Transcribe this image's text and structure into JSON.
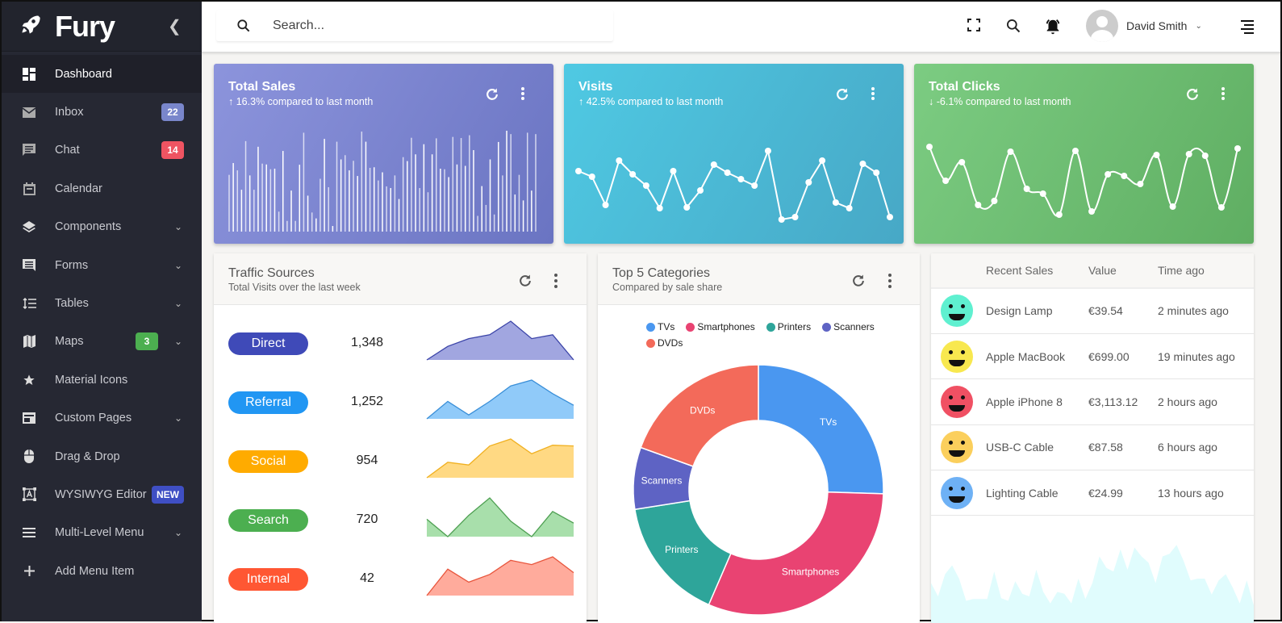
{
  "brand": {
    "name": "Fury"
  },
  "sidebar": {
    "items": [
      {
        "label": "Dashboard",
        "icon": "dashboard-icon",
        "active": true
      },
      {
        "label": "Inbox",
        "icon": "mail-icon",
        "badge": "22",
        "badge_color": "#7986cb"
      },
      {
        "label": "Chat",
        "icon": "chat-icon",
        "badge": "14",
        "badge_color": "#ef5462"
      },
      {
        "label": "Calendar",
        "icon": "calendar-icon"
      },
      {
        "label": "Components",
        "icon": "layers-icon",
        "expandable": true
      },
      {
        "label": "Forms",
        "icon": "forms-icon",
        "expandable": true
      },
      {
        "label": "Tables",
        "icon": "tables-icon",
        "expandable": true
      },
      {
        "label": "Maps",
        "icon": "map-icon",
        "badge": "3",
        "badge_color": "#4caf50",
        "expandable": true
      },
      {
        "label": "Material Icons",
        "icon": "star-icon"
      },
      {
        "label": "Custom Pages",
        "icon": "pages-icon",
        "expandable": true
      },
      {
        "label": "Drag & Drop",
        "icon": "mouse-icon"
      },
      {
        "label": "WYSIWYG Editor",
        "icon": "editor-icon",
        "badge": "NEW",
        "badge_color": "#3f4fc4"
      },
      {
        "label": "Multi-Level Menu",
        "icon": "menu-icon",
        "expandable": true
      },
      {
        "label": "Add Menu Item",
        "icon": "plus-icon"
      }
    ]
  },
  "topbar": {
    "search_placeholder": "Search...",
    "user_name": "David Smith"
  },
  "stats": [
    {
      "title": "Total Sales",
      "subtitle": "16.3% compared to last month",
      "trend": "up",
      "colors": [
        "#8c94dc",
        "#6a74c2"
      ]
    },
    {
      "title": "Visits",
      "subtitle": "42.5% compared to last month",
      "trend": "up",
      "colors": [
        "#4fc9e3",
        "#47a8c6"
      ]
    },
    {
      "title": "Total Clicks",
      "subtitle": "-6.1% compared to last month",
      "trend": "down",
      "colors": [
        "#7ccc82",
        "#5fae62"
      ]
    }
  ],
  "traffic": {
    "title": "Traffic Sources",
    "subtitle": "Total Visits over the last week",
    "rows": [
      {
        "label": "Direct",
        "value": "1,348",
        "color": "#3f4ab8",
        "fill": "#a1a6e0",
        "line": "#3b44a8",
        "spark": [
          0,
          35,
          55,
          65,
          100,
          55,
          65,
          0
        ]
      },
      {
        "label": "Referral",
        "value": "1,252",
        "color": "#2196f3",
        "fill": "#90caf9",
        "line": "#3a8fd8",
        "spark": [
          0,
          45,
          10,
          45,
          85,
          100,
          65,
          35
        ]
      },
      {
        "label": "Social",
        "value": "954",
        "color": "#ffab00",
        "fill": "#ffd983",
        "line": "#f0b020",
        "spark": [
          0,
          40,
          33,
          82,
          100,
          62,
          84,
          82
        ]
      },
      {
        "label": "Search",
        "value": "720",
        "color": "#4caf50",
        "fill": "#a8dfab",
        "line": "#4d9f51",
        "spark": [
          45,
          0,
          55,
          100,
          40,
          0,
          65,
          35
        ]
      },
      {
        "label": "Internal",
        "value": "42",
        "color": "#ff5733",
        "fill": "#ffab9c",
        "line": "#e8553c",
        "spark": [
          0,
          75,
          38,
          60,
          100,
          88,
          110,
          65
        ]
      }
    ]
  },
  "categories": {
    "title": "Top 5 Categories",
    "subtitle": "Compared by sale share"
  },
  "chart_data": [
    {
      "type": "bar",
      "title": "Total Sales",
      "values": [
        202,
        244,
        218,
        149,
        322,
        200,
        149,
        302,
        242,
        239,
        222,
        224,
        71,
        287,
        38,
        146,
        38,
        238,
        352,
        128,
        68,
        47,
        188,
        330,
        158,
        20,
        320,
        257,
        272,
        218,
        252,
        198,
        356,
        320,
        227,
        229,
        182,
        211,
        161,
        155,
        200,
        116,
        265,
        251,
        334,
        275,
        155,
        311,
        140,
        275,
        332,
        224,
        222,
        194,
        337,
        239,
        333,
        234,
        343,
        290,
        56,
        162,
        95,
        257,
        61,
        319,
        200,
        359,
        347,
        132,
        202,
        111,
        352,
        146,
        347
      ]
    },
    {
      "type": "line",
      "title": "Visits",
      "values": [
        62,
        55,
        20,
        75,
        58,
        44,
        16,
        62,
        17,
        38,
        70,
        60,
        52,
        44,
        87,
        2,
        5,
        48,
        75,
        23,
        16,
        71,
        60,
        5
      ]
    },
    {
      "type": "line",
      "title": "Total Clicks",
      "values": [
        92,
        50,
        73,
        20,
        25,
        86,
        40,
        34,
        8,
        87,
        12,
        58,
        56,
        46,
        82,
        18,
        83,
        81,
        17,
        90
      ]
    },
    {
      "type": "pie",
      "title": "Top 5 Categories",
      "labels": [
        "TVs",
        "Smartphones",
        "Printers",
        "Scanners",
        "DVDs"
      ],
      "values": [
        25.5,
        31,
        16,
        8,
        19.5
      ],
      "colors": [
        "#4a97f0",
        "#e94372",
        "#2ea59a",
        "#5e63c4",
        "#f36a5a"
      ],
      "legend": "top"
    },
    {
      "type": "area",
      "title": "Recent Sales background",
      "values": [
        45,
        30,
        55,
        65,
        50,
        25,
        27,
        27,
        27,
        58,
        28,
        25,
        47,
        33,
        30,
        60,
        35,
        22,
        35,
        33,
        22,
        50,
        27,
        45,
        75,
        62,
        58,
        83,
        60,
        85,
        75,
        68,
        45,
        75,
        78,
        88,
        70,
        48,
        50,
        50,
        32,
        48,
        55,
        40,
        22,
        48,
        20
      ]
    }
  ],
  "recent_sales": {
    "columns": [
      "",
      "Recent Sales",
      "Value",
      "Time ago"
    ],
    "rows": [
      {
        "name": "Design Lamp",
        "value": "€39.54",
        "time": "2 minutes ago",
        "avatar_color": "#5ff0d0"
      },
      {
        "name": "Apple MacBook",
        "value": "€699.00",
        "time": "19 minutes ago",
        "avatar_color": "#f8e84f"
      },
      {
        "name": "Apple iPhone 8",
        "value": "€3,113.12",
        "time": "2 hours ago",
        "avatar_color": "#f05063"
      },
      {
        "name": "USB-C Cable",
        "value": "€87.58",
        "time": "6 hours ago",
        "avatar_color": "#fbcf5c"
      },
      {
        "name": "Lighting Cable",
        "value": "€24.99",
        "time": "13 hours ago",
        "avatar_color": "#6eb1f5"
      }
    ]
  }
}
